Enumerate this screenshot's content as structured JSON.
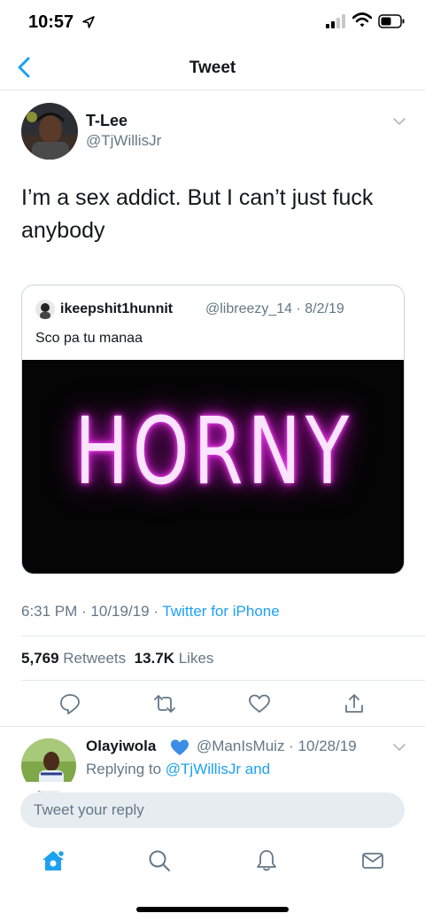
{
  "status_bar": {
    "time": "10:57",
    "icons": [
      "location-arrow-icon",
      "cellular-signal-icon",
      "wifi-icon",
      "battery-icon"
    ]
  },
  "nav": {
    "title": "Tweet",
    "back_icon": "chevron-left-icon"
  },
  "tweet": {
    "author_name": "T-Lee",
    "author_handle": "@TjWillisJr",
    "text": "I’m a sex addict. But I can’t just fuck anybody",
    "quoted": {
      "author_name": "ikeepshit1hunnit",
      "handle_date": "@libreezy_14 · 8/2/19",
      "text": "Sco pa tu manaa",
      "image_text": "HORNY"
    },
    "time_date": "6:31 PM · 10/19/19 · ",
    "source": "Twitter for iPhone",
    "retweets_count": "5,769",
    "retweets_label": "Retweets",
    "likes_count": "13.7K",
    "likes_label": "Likes",
    "actions": [
      "reply-icon",
      "retweet-icon",
      "like-icon",
      "share-icon"
    ]
  },
  "reply": {
    "author_name": "Olayiwola",
    "handle_date": "@ManIsMuiz · 10/28/19",
    "replying_prefix": "Replying to ",
    "replying_mention": "@TjWillisJr and"
  },
  "compose": {
    "placeholder": "Tweet your reply"
  },
  "tab_bar": {
    "items": [
      "home-icon",
      "search-icon",
      "notifications-icon",
      "messages-icon"
    ]
  },
  "colors": {
    "accent": "#1da1f2",
    "secondary_text": "#657786",
    "divider": "#e1e8ed",
    "neon": "#ff4cff"
  }
}
